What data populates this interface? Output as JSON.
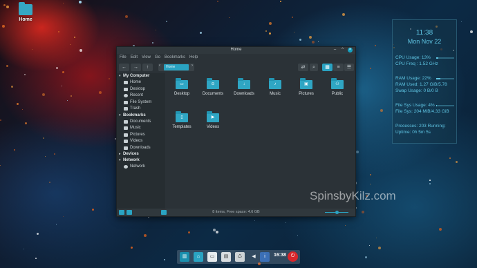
{
  "desktop": {
    "icon_label": "Home",
    "watermark": "SpinsbyKilz.com"
  },
  "window": {
    "title": "Home",
    "menu": [
      "File",
      "Edit",
      "View",
      "Go",
      "Bookmarks",
      "Help"
    ],
    "path_label": "Home",
    "sidebar": {
      "my_computer": {
        "header": "My Computer",
        "items": [
          "Home",
          "Desktop",
          "Recent",
          "File System",
          "Trash"
        ]
      },
      "bookmarks": {
        "header": "Bookmarks",
        "items": [
          "Documents",
          "Music",
          "Pictures",
          "Videos",
          "Downloads"
        ]
      },
      "devices": {
        "header": "Devices"
      },
      "network": {
        "header": "Network",
        "items": [
          "Network"
        ]
      }
    },
    "files": [
      "Desktop",
      "Documents",
      "Downloads",
      "Music",
      "Pictures",
      "Public",
      "Templates",
      "Videos"
    ],
    "status": "8 items, Free space: 4.6 GB",
    "zoom_level": 0.5
  },
  "conky": {
    "time": "11:38",
    "date": "Mon Nov 22",
    "cpu_usage": "CPU Usage: 13%",
    "cpu_freq": "CPU Freq : 1.52 GHz",
    "ram_usage": "RAM Usage: 22%",
    "ram_used": "RAM Used: 1.27 GiB/5.78",
    "swap_usage": "Swap Usage: 0 B/0 B",
    "fs_usage": "File Sys Usage:  4%",
    "fs_detail": "File Sys: 204 MiB/4.33 GiB",
    "processes": "Processes: 203   Running:",
    "uptime": "Uptime: 0h 5m 5s",
    "cpu_fraction": 0.13,
    "ram_fraction": 0.22,
    "fs_fraction": 0.04
  },
  "dock": {
    "clock": "16:38"
  }
}
